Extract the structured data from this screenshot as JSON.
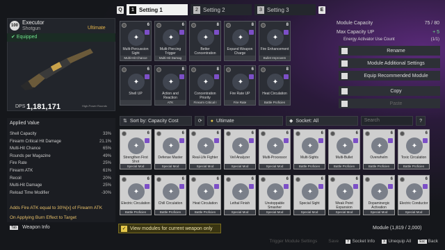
{
  "tabs": {
    "left_key": "Q",
    "right_key": "E",
    "items": [
      {
        "num": "1",
        "label": "Setting 1"
      },
      {
        "num": "2",
        "label": "Setting 2"
      },
      {
        "num": "3",
        "label": "Setting 3"
      }
    ]
  },
  "weapon": {
    "level": "100",
    "name": "Executor",
    "type": "Shotgun",
    "tier": "Ultimate",
    "equipped": "Equipped",
    "dps_label": "DPS",
    "dps_value": "1,181,171",
    "round_label": "High-Power Rounds"
  },
  "stats": {
    "header": "Applied Value",
    "rows": [
      {
        "label": "Shell Capacity",
        "value": "33%"
      },
      {
        "label": "Firearm Critical Hit Damage",
        "value": "21.1%"
      },
      {
        "label": "Multi-Hit Chance",
        "value": "65%"
      },
      {
        "label": "Rounds per Magazine",
        "value": "49%"
      },
      {
        "label": "Fire Rate",
        "value": "25%"
      },
      {
        "label": "Firearm ATK",
        "value": "61%"
      },
      {
        "label": "Recoil",
        "value": "20%"
      },
      {
        "label": "Multi-Hit Damage",
        "value": "25%"
      },
      {
        "label": "Reload Time Modifier",
        "value": "-30%"
      }
    ],
    "effect1": "Adds Fire ATK equal to 30%[x] of Firearm ATK",
    "effect2": "On Applying Burn Effect to Target",
    "info_key": "Tab",
    "info_label": "Weapon Info"
  },
  "equipped": [
    {
      "cost": "6",
      "name": "Multi-Percussion Sight",
      "foot": "Multi-Hit Chance"
    },
    {
      "cost": "6",
      "name": "Multi-Piercing Trigger",
      "foot": "Multi-Hit Damag"
    },
    {
      "cost": "8",
      "name": "Better Concentration",
      "foot": ""
    },
    {
      "cost": "8",
      "name": "Expand Weapon Charge",
      "foot": ""
    },
    {
      "cost": "8",
      "name": "Fire Enhancement",
      "foot": "Bullet Improvem"
    },
    {
      "cost": "6",
      "name": "Shell UP",
      "foot": ""
    },
    {
      "cost": "8",
      "name": "Action and Reaction",
      "foot": "ATK"
    },
    {
      "cost": "8",
      "name": "Concentration Priority",
      "foot": "Firearm Critical I"
    },
    {
      "cost": "6",
      "name": "Fire Rate UP",
      "foot": "Fire Rate"
    },
    {
      "cost": "8",
      "name": "Heat Circulation",
      "foot": "Battle Proficien"
    }
  ],
  "right": {
    "cap_label": "Module Capacity",
    "cap_value": "75 / 80",
    "max_label": "Max Capacity UP",
    "max_value": "+ 5",
    "activator": "Energy Activator Use Count",
    "activator_value": "(1/1)",
    "buttons": [
      {
        "key": "",
        "label": "Rename"
      },
      {
        "key": "",
        "label": "Module Additional Settings"
      },
      {
        "key": "",
        "label": "Equip Recommended Module"
      },
      {
        "key": "",
        "label": "Copy"
      },
      {
        "key": "",
        "label": "Paste"
      }
    ]
  },
  "filters": {
    "sort": "Sort by: Capacity Cost",
    "tier": "Ultimate",
    "socket": "Socket: All",
    "search_placeholder": "Search"
  },
  "modules": [
    {
      "cost": "6",
      "name": "Strengthen First Shot",
      "foot": "Special Mod"
    },
    {
      "cost": "6",
      "name": "Defense Master",
      "foot": "Special Mod"
    },
    {
      "cost": "6",
      "name": "Real-Life Fighter",
      "foot": "Special Mod"
    },
    {
      "cost": "6",
      "name": "Veil Analyzer",
      "foot": "Special Mod"
    },
    {
      "cost": "6",
      "name": "Multi-Processor",
      "foot": "Special Mod"
    },
    {
      "cost": "6",
      "name": "Multi-Sights",
      "foot": "Battle Proficien"
    },
    {
      "cost": "6",
      "name": "Multi-Bullet",
      "foot": "Battle Proficien"
    },
    {
      "cost": "6",
      "name": "Overwhelm",
      "foot": "Battle Proficien"
    },
    {
      "cost": "6",
      "name": "Toxic Circulation",
      "foot": "Battle Proficien"
    },
    {
      "cost": "6",
      "name": "Electric Circulation",
      "foot": "Battle Proficien"
    },
    {
      "cost": "6",
      "name": "Chill Circulation",
      "foot": "Battle Proficien"
    },
    {
      "cost": "6",
      "name": "Heat Circulation",
      "foot": "Battle Proficien"
    },
    {
      "cost": "6",
      "name": "Lethal Finish",
      "foot": "Special Mod"
    },
    {
      "cost": "6",
      "name": "Unstoppable Smasher",
      "foot": "Special Mod"
    },
    {
      "cost": "6",
      "name": "Special Sight",
      "foot": "Special Mod"
    },
    {
      "cost": "6",
      "name": "Weak Point Expansion",
      "foot": "Special Mod"
    },
    {
      "cost": "6",
      "name": "Dopaminergic Activation",
      "foot": "Special Mod"
    },
    {
      "cost": "6",
      "name": "Electric Conductor",
      "foot": "Special Mod"
    }
  ],
  "bottom": {
    "view_toggle": "View modules for current weapon only",
    "module_count": "Module (1,819 / 2,000)",
    "hints": [
      {
        "key": "",
        "label": "Trigger Module Settings",
        "disabled": true
      },
      {
        "key": "",
        "label": "Save",
        "disabled": true
      },
      {
        "key": "Y",
        "label": "Socket Info",
        "disabled": false
      },
      {
        "key": "X",
        "label": "Unequip All",
        "disabled": false
      },
      {
        "key": "Esc",
        "label": "Back",
        "disabled": false
      }
    ]
  }
}
